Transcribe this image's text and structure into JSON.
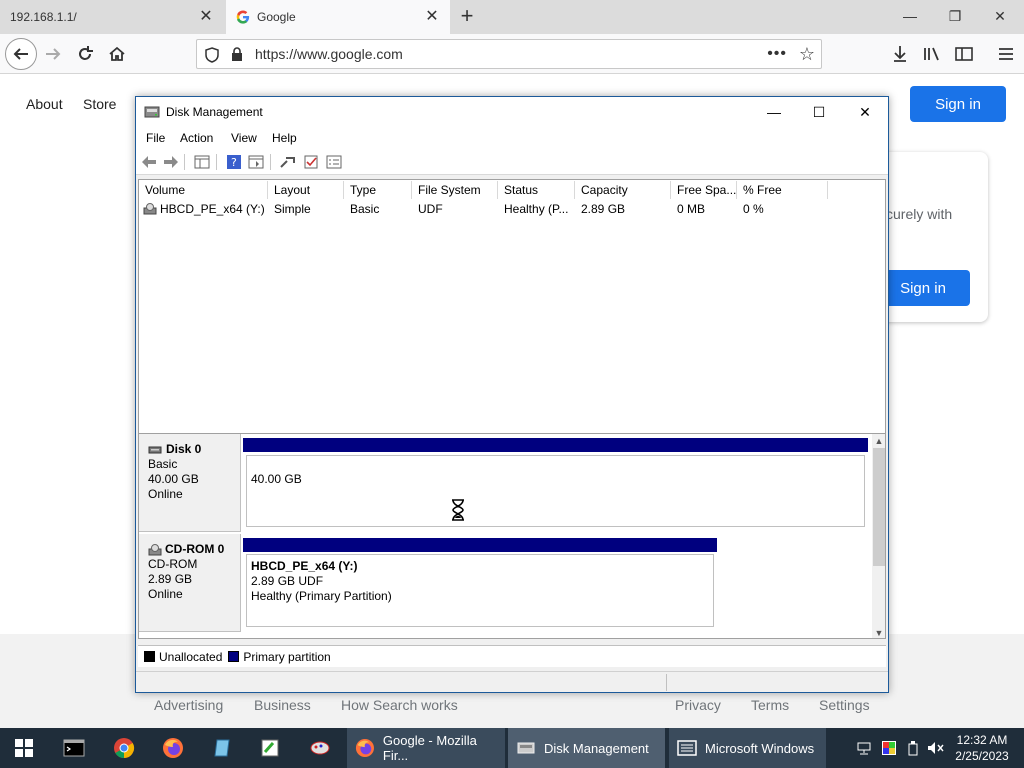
{
  "browser": {
    "tabs": [
      {
        "title": "192.168.1.1/",
        "active": false
      },
      {
        "title": "Google",
        "active": true
      }
    ],
    "url": "https://www.google.com"
  },
  "google": {
    "nav": {
      "about": "About",
      "store": "Store"
    },
    "signin": "Sign in",
    "card": {
      "text": "curely with",
      "button": "Sign in"
    },
    "footer": {
      "advertising": "Advertising",
      "business": "Business",
      "how": "How Search works",
      "privacy": "Privacy",
      "terms": "Terms",
      "settings": "Settings"
    },
    "colors": {
      "primary": "#1a73e8"
    }
  },
  "disk_management": {
    "title": "Disk Management",
    "menu": [
      "File",
      "Action",
      "View",
      "Help"
    ],
    "columns": [
      "Volume",
      "Layout",
      "Type",
      "File System",
      "Status",
      "Capacity",
      "Free Spa...",
      "% Free"
    ],
    "volumes": [
      {
        "volume": "HBCD_PE_x64 (Y:)",
        "layout": "Simple",
        "type": "Basic",
        "fs": "UDF",
        "status": "Healthy (P...",
        "capacity": "2.89 GB",
        "free": "0 MB",
        "pct": "0 %"
      }
    ],
    "disks": [
      {
        "name": "Disk 0",
        "type": "Basic",
        "size": "40.00 GB",
        "state": "Online",
        "partition": {
          "line1": "40.00 GB"
        }
      },
      {
        "name": "CD-ROM 0",
        "type": "CD-ROM",
        "size": "2.89 GB",
        "state": "Online",
        "partition": {
          "name": "HBCD_PE_x64  (Y:)",
          "line2": "2.89 GB UDF",
          "line3": "Healthy (Primary Partition)"
        }
      }
    ],
    "legend": {
      "unallocated": "Unallocated",
      "primary": "Primary partition"
    },
    "colors": {
      "primary": "#00007f",
      "unallocated": "#000000"
    }
  },
  "taskbar": {
    "apps": [
      {
        "label": "Google - Mozilla Fir..."
      },
      {
        "label": "Disk Management"
      },
      {
        "label": "Microsoft Windows"
      }
    ],
    "time": "12:32 AM",
    "date": "2/25/2023"
  }
}
